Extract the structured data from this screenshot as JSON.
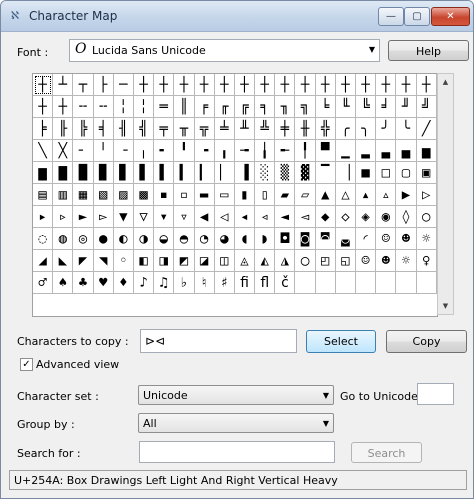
{
  "window": {
    "title": "Character Map",
    "buttons": {
      "minimize": "—",
      "maximize": "▢",
      "close": "✕"
    },
    "icon_glyph": "ℵ"
  },
  "font": {
    "label": "Font :",
    "selected": "Lucida Sans Unicode",
    "glyph": "O"
  },
  "help_label": "Help",
  "grid": {
    "characters": [
      "┼",
      "┴",
      "┬",
      "├",
      "─",
      "┼",
      "┼",
      "┼",
      "┼",
      "┼",
      "┼",
      "┼",
      "┼",
      "┼",
      "┼",
      "┼",
      "┼",
      "┼",
      "┼",
      "┼",
      "┼",
      "┼",
      "╌",
      "╌",
      "╎",
      "╎",
      "═",
      "║",
      "╒",
      "╓",
      "╔",
      "╕",
      "╖",
      "╗",
      "╘",
      "╙",
      "╚",
      "╛",
      "╜",
      "╝",
      "╞",
      "╟",
      "╠",
      "╡",
      "╢",
      "╣",
      "╤",
      "╥",
      "╦",
      "╧",
      "╨",
      "╩",
      "╪",
      "╫",
      "╬",
      "╭",
      "╮",
      "╯",
      "╰",
      "╱",
      "╲",
      "╳",
      "╴",
      "╵",
      "╶",
      "╷",
      "╸",
      "╹",
      "╺",
      "╻",
      "╼",
      "╽",
      "╾",
      "╿",
      "▀",
      "▁",
      "▂",
      "▃",
      "▄",
      "▅",
      "▆",
      "▇",
      "█",
      "▉",
      "▊",
      "▋",
      "▌",
      "▍",
      "▎",
      "▏",
      "▐",
      "░",
      "▒",
      "▓",
      "▔",
      "▕",
      "■",
      "□",
      "▢",
      "▣",
      "▤",
      "▥",
      "▦",
      "▧",
      "▨",
      "▩",
      "▪",
      "▫",
      "▬",
      "▭",
      "▮",
      "▯",
      "▰",
      "▱",
      "▲",
      "△",
      "▴",
      "▵",
      "▶",
      "▷",
      "▸",
      "▹",
      "►",
      "▻",
      "▼",
      "▽",
      "▾",
      "▿",
      "◀",
      "◁",
      "◂",
      "◃",
      "◄",
      "◅",
      "◆",
      "◇",
      "◈",
      "◉",
      "◊",
      "○",
      "◌",
      "◍",
      "◎",
      "●",
      "◐",
      "◑",
      "◒",
      "◓",
      "◔",
      "◕",
      "◖",
      "◗",
      "◘",
      "◙",
      "◚",
      "◛",
      "◜",
      "☺",
      "☻",
      "☼",
      "◢",
      "◣",
      "◤",
      "◥",
      "◦",
      "◧",
      "◨",
      "◩",
      "◪",
      "◫",
      "◬",
      "◭",
      "◮",
      "◯",
      "◰",
      "◱",
      "☺",
      "☻",
      "☼",
      "♀",
      "♂",
      "♠",
      "♣",
      "♥",
      "♦",
      "♪",
      "♫",
      "♭",
      "♮",
      "♯",
      "ﬁ",
      "ﬂ",
      "č",
      "",
      "",
      "",
      "",
      "",
      "",
      ""
    ],
    "rows": 11,
    "cols": 20,
    "selected_index": 0
  },
  "copy": {
    "label": "Characters to copy :",
    "value": "⊳⊲",
    "select_label": "Select",
    "copy_label": "Copy"
  },
  "advanced": {
    "label": "Advanced view",
    "checked": true,
    "check_glyph": "✓"
  },
  "charset": {
    "label": "Character set :",
    "value": "Unicode",
    "goto_label": "Go to Unicode :",
    "goto_value": ""
  },
  "groupby": {
    "label": "Group by :",
    "value": "All"
  },
  "search": {
    "label": "Search for :",
    "value": "",
    "button_label": "Search"
  },
  "status": "U+254A: Box Drawings Left Light And Right Vertical Heavy"
}
